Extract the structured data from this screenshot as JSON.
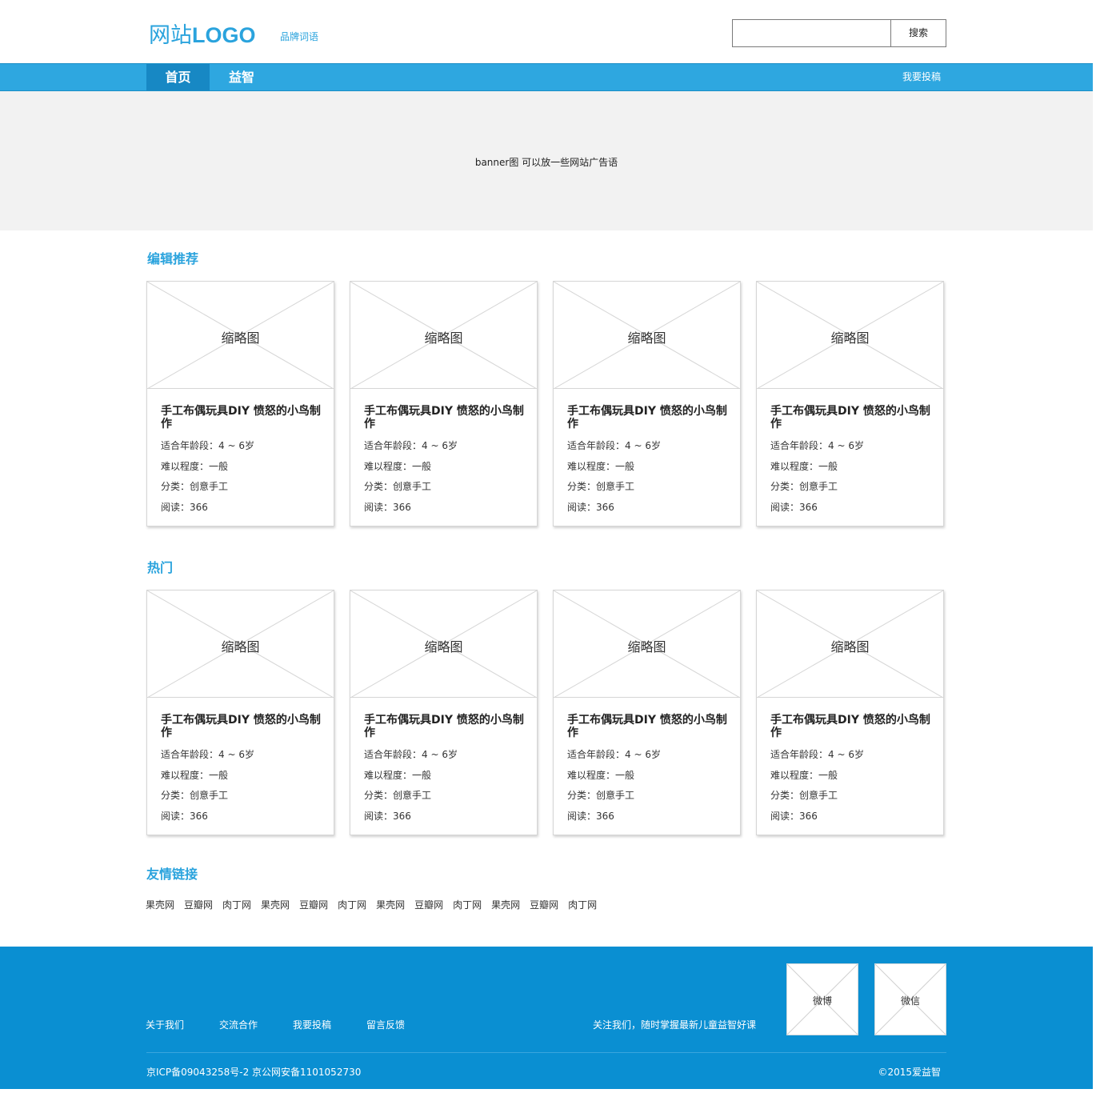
{
  "header": {
    "logo_cn": "网站",
    "logo_en": "LOGO",
    "brand_words": "品牌词语",
    "search_value": "",
    "search_button": "搜索"
  },
  "nav": {
    "items": [
      {
        "label": "首页",
        "active": true
      },
      {
        "label": "益智",
        "active": false
      }
    ],
    "submit_label": "我要投稿"
  },
  "banner": {
    "text": "banner图 可以放一些网站广告语"
  },
  "sections": {
    "editor_pick": {
      "title": "编辑推荐",
      "cards": [
        {
          "thumb": "缩略图",
          "title": "手工布偶玩具DIY 愤怒的小鸟制作",
          "age": "适合年龄段：4 ~ 6岁",
          "difficulty": "难以程度：一般",
          "category": "分类：创意手工",
          "reads": "阅读：366"
        },
        {
          "thumb": "缩略图",
          "title": "手工布偶玩具DIY 愤怒的小鸟制作",
          "age": "适合年龄段：4 ~ 6岁",
          "difficulty": "难以程度：一般",
          "category": "分类：创意手工",
          "reads": "阅读：366"
        },
        {
          "thumb": "缩略图",
          "title": "手工布偶玩具DIY 愤怒的小鸟制作",
          "age": "适合年龄段：4 ~ 6岁",
          "difficulty": "难以程度：一般",
          "category": "分类：创意手工",
          "reads": "阅读：366"
        },
        {
          "thumb": "缩略图",
          "title": "手工布偶玩具DIY 愤怒的小鸟制作",
          "age": "适合年龄段：4 ~ 6岁",
          "difficulty": "难以程度：一般",
          "category": "分类：创意手工",
          "reads": "阅读：366"
        }
      ]
    },
    "hot": {
      "title": "热门",
      "cards": [
        {
          "thumb": "缩略图",
          "title": "手工布偶玩具DIY 愤怒的小鸟制作",
          "age": "适合年龄段：4 ~ 6岁",
          "difficulty": "难以程度：一般",
          "category": "分类：创意手工",
          "reads": "阅读：366"
        },
        {
          "thumb": "缩略图",
          "title": "手工布偶玩具DIY 愤怒的小鸟制作",
          "age": "适合年龄段：4 ~ 6岁",
          "difficulty": "难以程度：一般",
          "category": "分类：创意手工",
          "reads": "阅读：366"
        },
        {
          "thumb": "缩略图",
          "title": "手工布偶玩具DIY 愤怒的小鸟制作",
          "age": "适合年龄段：4 ~ 6岁",
          "difficulty": "难以程度：一般",
          "category": "分类：创意手工",
          "reads": "阅读：366"
        },
        {
          "thumb": "缩略图",
          "title": "手工布偶玩具DIY 愤怒的小鸟制作",
          "age": "适合年龄段：4 ~ 6岁",
          "difficulty": "难以程度：一般",
          "category": "分类：创意手工",
          "reads": "阅读：366"
        }
      ]
    },
    "links": {
      "title": "友情链接",
      "items": [
        "果壳网",
        "豆瓣网",
        "肉丁网",
        "果壳网",
        "豆瓣网",
        "肉丁网",
        "果壳网",
        "豆瓣网",
        "肉丁网",
        "果壳网",
        "豆瓣网",
        "肉丁网"
      ]
    }
  },
  "footer": {
    "links": [
      "关于我们",
      "交流合作",
      "我要投稿",
      "留言反馈"
    ],
    "follow_text": "关注我们，随时掌握最新儿童益智好课",
    "qr": [
      "微博",
      "微信"
    ],
    "icp": "京ICP备09043258号-2  京公网安备1101052730",
    "copyright": "©2015爱益智"
  },
  "colors": {
    "accent": "#2aa3dd",
    "nav_bg": "#2ea7e0",
    "nav_active": "#1788c4",
    "footer_bg": "#0a8fd2",
    "banner_bg": "#f2f2f2"
  }
}
